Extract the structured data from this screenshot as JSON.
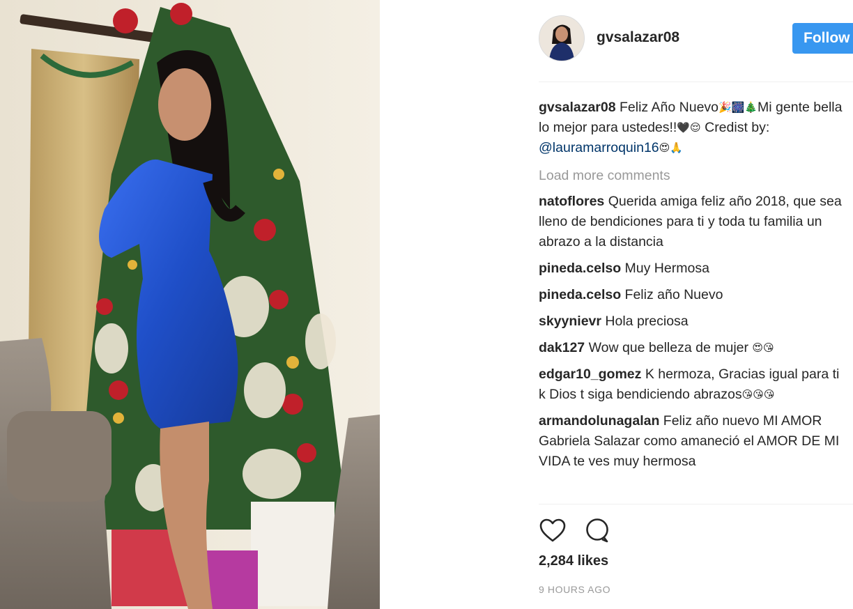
{
  "post": {
    "username": "gvsalazar08",
    "follow_label": "Follow",
    "caption": {
      "user": "gvsalazar08",
      "text_a": " Feliz Año Nuevo",
      "emoji_a": "🎉🎆🎄",
      "text_b": "Mi gente bella lo mejor para ustedes!!",
      "emoji_b": "🖤😌",
      "text_c": " Credist by: ",
      "mention": "@lauramarroquin16",
      "emoji_c": " 😍🙏"
    },
    "load_more": "Load more comments",
    "comments": [
      {
        "user": "natoflores",
        "text": "Querida amiga feliz año 2018, que sea lleno de bendiciones para ti y toda tu familia un abrazo a la distancia",
        "emoji": ""
      },
      {
        "user": "pineda.celso",
        "text": "Muy Hermosa",
        "emoji": ""
      },
      {
        "user": "pineda.celso",
        "text": "Feliz año Nuevo",
        "emoji": ""
      },
      {
        "user": "skyynievr",
        "text": "Hola preciosa",
        "emoji": ""
      },
      {
        "user": "dak127",
        "text": "Wow que belleza de mujer",
        "emoji": "😍😘"
      },
      {
        "user": "edgar10_gomez",
        "text": "K hermoza, Gracias igual para ti k Dios t siga bendiciendo abrazos",
        "emoji": "😘😘😘"
      },
      {
        "user": "armandolunagalan",
        "text": "Feliz año nuevo MI AMOR Gabriela Salazar como amaneció el AMOR DE MI VIDA te ves muy hermosa",
        "emoji": ""
      }
    ],
    "likes": "2,284 likes",
    "time": "9 HOURS AGO"
  },
  "icons": {
    "like": "heart-icon",
    "comment": "comment-bubble-icon"
  },
  "colors": {
    "follow_button": "#3897f0",
    "mention": "#003569",
    "muted": "#999999",
    "dress": "#1f4fc8"
  }
}
